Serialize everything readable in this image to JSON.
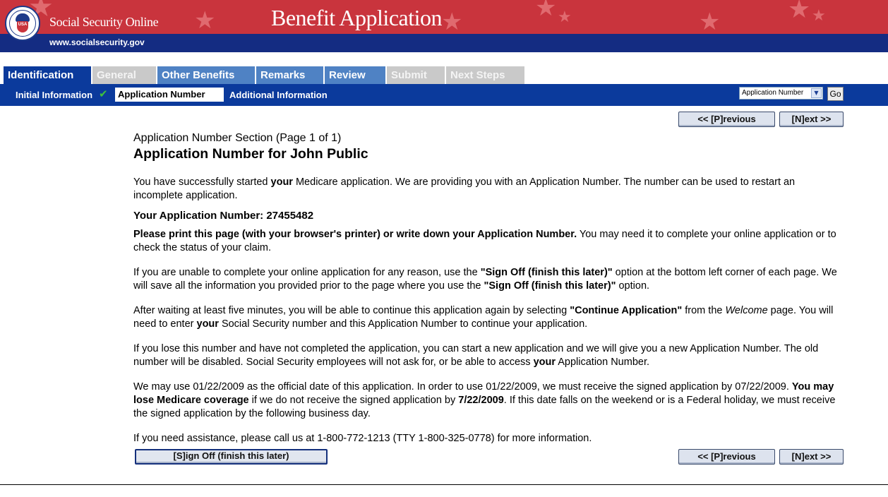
{
  "banner": {
    "site_name": "Social Security Online",
    "app_title": "Benefit Application",
    "url": "www.socialsecurity.gov",
    "seal_text": "USA",
    "colors": {
      "red": "#c9343d",
      "navy": "#142c82"
    }
  },
  "tabs": [
    {
      "label": "Identification",
      "state": "active"
    },
    {
      "label": "General",
      "state": "disabled"
    },
    {
      "label": "Other Benefits",
      "state": "enabled"
    },
    {
      "label": "Remarks",
      "state": "enabled"
    },
    {
      "label": "Review",
      "state": "enabled"
    },
    {
      "label": "Submit",
      "state": "disabled"
    },
    {
      "label": "Next Steps",
      "state": "disabled"
    }
  ],
  "subnav": {
    "items": [
      {
        "label": "Initial Information",
        "completed": true
      },
      {
        "label": "Application Number",
        "current": true
      },
      {
        "label": "Additional Information"
      }
    ],
    "select_value": "Application Number",
    "go_label": "Go"
  },
  "nav": {
    "previous_label": "<< [P]revious",
    "next_label": "[N]ext >>",
    "signoff_label": "[S]ign Off (finish this later)"
  },
  "content": {
    "section_label": "Application Number Section (Page 1 of 1)",
    "title": "Application Number for John Public",
    "p1": {
      "a": "You have successfully started ",
      "b": "your",
      "c": " Medicare application. We are providing you with an Application Number. The number can be used to restart an incomplete application."
    },
    "app_number_label": "Your Application Number: ",
    "app_number": "27455482",
    "p2": {
      "bold": "Please print this page (with your browser's printer) or write down your Application Number.",
      "rest": " You may need it to complete your online application or to check the status of your claim."
    },
    "p3": {
      "a": "If you are unable to complete your online application for any reason, use the ",
      "b": "\"Sign Off (finish this later)\"",
      "c": " option at the bottom left corner of each page. We will save all the information you provided prior to the page where you use the ",
      "d": "\"Sign Off (finish this later)\"",
      "e": " option."
    },
    "p4": {
      "a": "After waiting at least five minutes, you will be able to continue this application again by selecting ",
      "b": "\"Continue Application\"",
      "c": " from the ",
      "d": "Welcome",
      "e": " page. You will need to enter ",
      "f": "your",
      "g": " Social Security number and this Application Number to continue your application."
    },
    "p5": {
      "a": "If you lose this number and have not completed the application, you can start a new application and we will give you a new Application Number. The old number will be disabled. Social Security employees will not ask for, or be able to access ",
      "b": "your",
      "c": " Application Number."
    },
    "p6": {
      "a": "We may use 01/22/2009 as the official date of this application. In order to use 01/22/2009, we must receive the signed application by 07/22/2009. ",
      "b": "You may lose Medicare coverage",
      "c": " if we do not receive the signed application by ",
      "d": "7/22/2009",
      "e": ". If this date falls on the weekend or is a Federal holiday, we must receive the signed application by the following business day."
    },
    "p7": "If you need assistance, please call us at 1-800-772-1213 (TTY 1-800-325-0778) for more information."
  }
}
